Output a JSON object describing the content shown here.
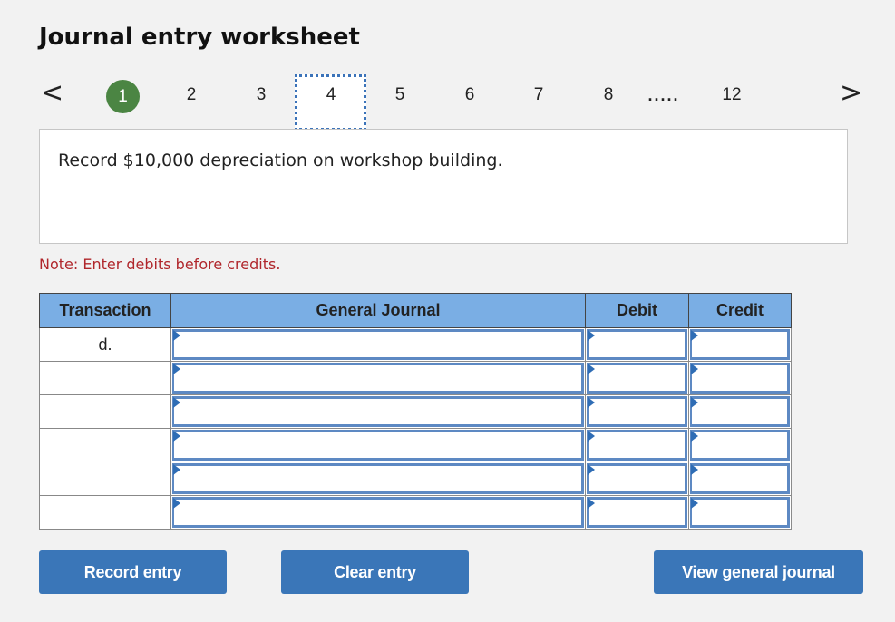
{
  "title": "Journal entry worksheet",
  "pager": {
    "prev_icon": "chevron-left-icon",
    "next_icon": "chevron-right-icon",
    "prev_glyph": "<",
    "next_glyph": ">",
    "pages": [
      "1",
      "2",
      "3",
      "4",
      "5",
      "6",
      "7",
      "8",
      ".....",
      "12"
    ],
    "completed_page": "1",
    "current_page": "4"
  },
  "question": "Record $10,000 depreciation on workshop building.",
  "note": "Note: Enter debits before credits.",
  "table": {
    "headers": [
      "Transaction",
      "General Journal",
      "Debit",
      "Credit"
    ],
    "rows": [
      {
        "transaction": "d.",
        "account": "",
        "debit": "",
        "credit": ""
      },
      {
        "transaction": "",
        "account": "",
        "debit": "",
        "credit": ""
      },
      {
        "transaction": "",
        "account": "",
        "debit": "",
        "credit": ""
      },
      {
        "transaction": "",
        "account": "",
        "debit": "",
        "credit": ""
      },
      {
        "transaction": "",
        "account": "",
        "debit": "",
        "credit": ""
      },
      {
        "transaction": "",
        "account": "",
        "debit": "",
        "credit": ""
      }
    ]
  },
  "buttons": {
    "record": "Record entry",
    "clear": "Clear entry",
    "view": "View general journal"
  },
  "colors": {
    "header_bg": "#7aaee4",
    "button_bg": "#3a76b8",
    "completed_circle": "#4b8543",
    "note_text": "#b0262b",
    "current_page_border": "#3b73b9"
  }
}
